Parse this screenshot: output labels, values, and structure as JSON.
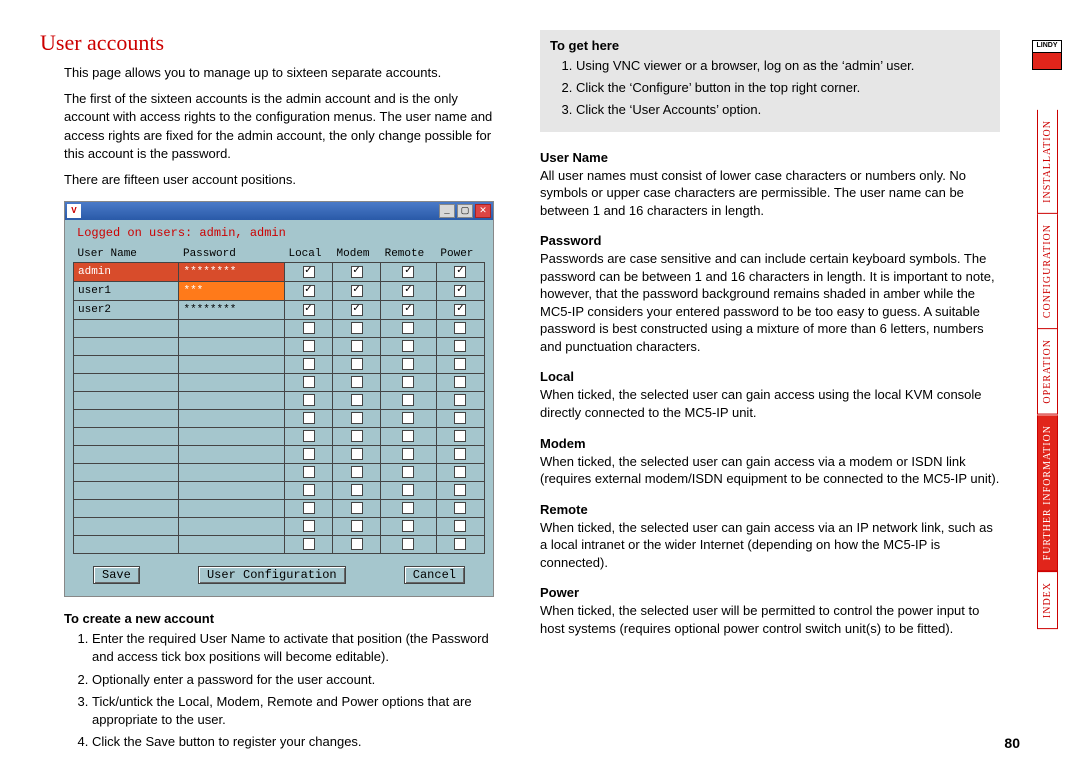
{
  "page_title": "User accounts",
  "intro": {
    "p1": "This page allows you to manage up to sixteen separate accounts.",
    "p2": "The first of the sixteen accounts is the admin account and is the only account with access rights to the configuration menus. The user name and access rights are fixed for the admin account, the only change possible for this account is the password.",
    "p3": "There are fifteen user account positions."
  },
  "screenshot": {
    "status": "Logged on users: admin, admin",
    "columns": {
      "c1": "User Name",
      "c2": "Password",
      "c3": "Local",
      "c4": "Modem",
      "c5": "Remote",
      "c6": "Power"
    },
    "rows": [
      {
        "user": "admin",
        "pw": "********",
        "local": true,
        "modem": true,
        "remote": true,
        "power": true,
        "admin": true,
        "amber": false
      },
      {
        "user": "user1",
        "pw": "***",
        "local": true,
        "modem": true,
        "remote": true,
        "power": true,
        "admin": false,
        "amber": true
      },
      {
        "user": "user2",
        "pw": "********",
        "local": true,
        "modem": true,
        "remote": true,
        "power": true,
        "admin": false,
        "amber": false
      },
      {
        "user": "",
        "pw": "",
        "local": false,
        "modem": false,
        "remote": false,
        "power": false
      },
      {
        "user": "",
        "pw": "",
        "local": false,
        "modem": false,
        "remote": false,
        "power": false
      },
      {
        "user": "",
        "pw": "",
        "local": false,
        "modem": false,
        "remote": false,
        "power": false
      },
      {
        "user": "",
        "pw": "",
        "local": false,
        "modem": false,
        "remote": false,
        "power": false
      },
      {
        "user": "",
        "pw": "",
        "local": false,
        "modem": false,
        "remote": false,
        "power": false
      },
      {
        "user": "",
        "pw": "",
        "local": false,
        "modem": false,
        "remote": false,
        "power": false
      },
      {
        "user": "",
        "pw": "",
        "local": false,
        "modem": false,
        "remote": false,
        "power": false
      },
      {
        "user": "",
        "pw": "",
        "local": false,
        "modem": false,
        "remote": false,
        "power": false
      },
      {
        "user": "",
        "pw": "",
        "local": false,
        "modem": false,
        "remote": false,
        "power": false
      },
      {
        "user": "",
        "pw": "",
        "local": false,
        "modem": false,
        "remote": false,
        "power": false
      },
      {
        "user": "",
        "pw": "",
        "local": false,
        "modem": false,
        "remote": false,
        "power": false
      },
      {
        "user": "",
        "pw": "",
        "local": false,
        "modem": false,
        "remote": false,
        "power": false
      },
      {
        "user": "",
        "pw": "",
        "local": false,
        "modem": false,
        "remote": false,
        "power": false
      }
    ],
    "buttons": {
      "save": "Save",
      "title": "User Configuration",
      "cancel": "Cancel"
    }
  },
  "create_heading": "To create a new account",
  "create_steps": [
    "Enter the required User Name to activate that position (the Password and access tick box positions will become editable).",
    "Optionally enter a password for the user account.",
    "Tick/untick the Local, Modem, Remote and Power options that are appropriate to the user.",
    "Click the Save button to register your changes."
  ],
  "togethere_heading": "To get here",
  "togethere_steps": [
    "Using VNC viewer or a browser, log on as the ‘admin’ user.",
    "Click the ‘Configure’ button in the top right corner.",
    "Click the ‘User Accounts’ option."
  ],
  "fields": {
    "username": {
      "h": "User Name",
      "p": "All user names must consist of lower case characters or numbers only. No symbols or upper case characters are permissible. The user name can be between 1 and 16 characters in length."
    },
    "password": {
      "h": "Password",
      "p": "Passwords are case sensitive and can include certain keyboard symbols. The password can be between 1 and 16 characters in length. It is important to note, however, that the password background remains shaded in amber while the MC5-IP considers your entered password to be too easy to guess. A suitable password is best constructed using a mixture of more than 6 letters, numbers and punctuation characters."
    },
    "local": {
      "h": "Local",
      "p": "When ticked, the selected user can gain access using the local KVM console directly connected to the MC5-IP unit."
    },
    "modem": {
      "h": "Modem",
      "p": "When ticked, the selected user can gain access via a modem or ISDN link (requires external modem/ISDN equipment to be connected to the MC5-IP unit)."
    },
    "remote": {
      "h": "Remote",
      "p": "When ticked, the selected user can gain access via an IP network link, such as a local intranet or the wider Internet (depending on how the MC5-IP is connected)."
    },
    "power": {
      "h": "Power",
      "p": "When ticked, the selected user will be permitted to control the power input to host systems (requires optional power control switch unit(s) to be fitted)."
    }
  },
  "nav": {
    "installation": "INSTALLATION",
    "configuration": "CONFIGURATION",
    "operation": "OPERATION",
    "further": "FURTHER INFORMATION",
    "index": "INDEX"
  },
  "page_number": "80",
  "logo_text": "LINDY"
}
